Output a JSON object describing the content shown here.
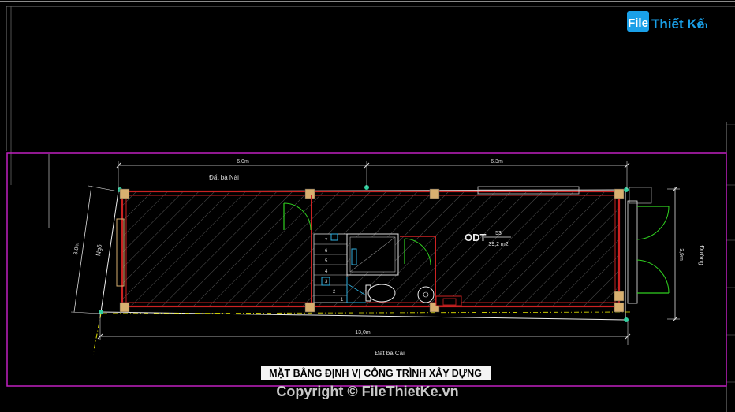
{
  "logo": {
    "file": "File",
    "rest": "Thiết Kế",
    "tld": ".vn"
  },
  "dimensions": {
    "top_left": "6.0m",
    "top_right": "6.3m",
    "bottom": "13,0m",
    "left": "3.8m",
    "right": "3,9m"
  },
  "neighbors": {
    "top": "Đất bà Nài",
    "bottom": "Đất bà Cải",
    "left": "Ngõ",
    "right": "Đường"
  },
  "zone": {
    "code": "ODT",
    "number": "53",
    "area": "39,2 m2"
  },
  "stair_steps": [
    "1",
    "2",
    "3",
    "4",
    "5",
    "6",
    "7"
  ],
  "title": "MẶT BẰNG ĐỊNH VỊ CÔNG TRÌNH XÂY DỰNG",
  "copyright": "Copyright © FileThietKe.vn",
  "colors": {
    "frame": "#c020c0",
    "wall": "#cc2222",
    "column": "#d8b070",
    "dimension": "#dddddd",
    "logo": "#1aa0e8",
    "background": "#000000"
  }
}
